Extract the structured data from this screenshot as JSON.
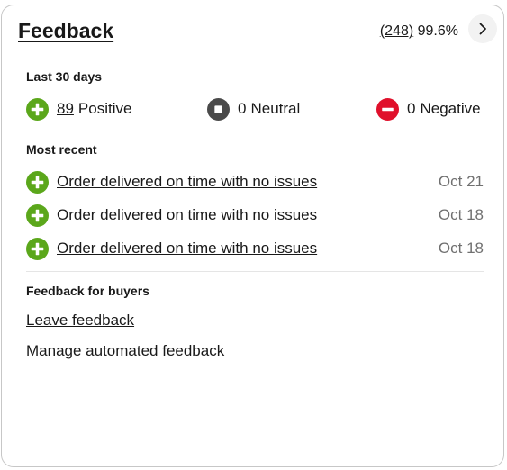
{
  "card": {
    "title": "Feedback",
    "score_count": "(248)",
    "score_percent": "99.6%",
    "chevron_icon": "chevron-right-icon"
  },
  "summary": {
    "label": "Last 30 days",
    "positive": {
      "count": "89",
      "label": "Positive",
      "icon": "plus-circle-icon",
      "color": "#5ba71b"
    },
    "neutral": {
      "count": "0",
      "label": "Neutral",
      "icon": "square-circle-icon",
      "color": "#4a4a4a"
    },
    "negative": {
      "count": "0",
      "label": "Negative",
      "icon": "minus-circle-icon",
      "color": "#e0102b"
    }
  },
  "recent": {
    "label": "Most recent",
    "items": [
      {
        "text": "Order delivered on time with no issues",
        "date": "Oct 21",
        "type": "positive"
      },
      {
        "text": "Order delivered on time with no issues",
        "date": "Oct 18",
        "type": "positive"
      },
      {
        "text": "Order delivered on time with no issues",
        "date": "Oct 18",
        "type": "positive"
      }
    ]
  },
  "buyers": {
    "label": "Feedback for buyers",
    "leave_feedback": "Leave feedback",
    "manage_automated": "Manage automated feedback"
  }
}
